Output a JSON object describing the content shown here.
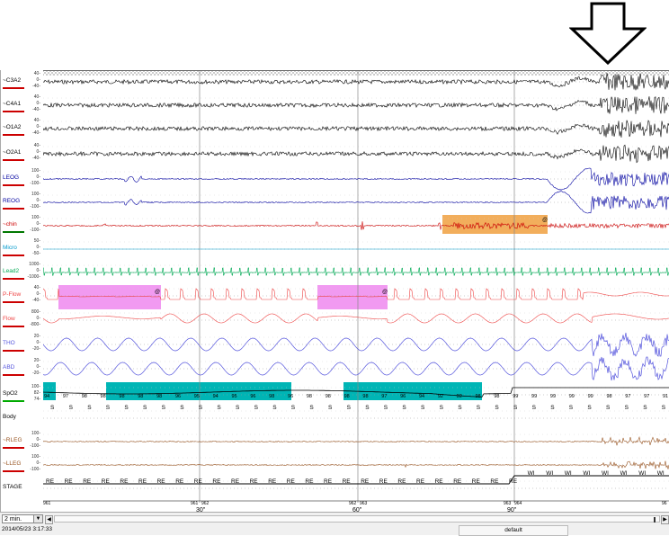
{
  "channels": [
    {
      "name": "~C3A2",
      "ticks": [
        "40-",
        "0-",
        "-40-"
      ],
      "color": "#000000",
      "underline": "#cc0000"
    },
    {
      "name": "~C4A1",
      "ticks": [
        "40-",
        "0-",
        "-40-"
      ],
      "color": "#000000",
      "underline": "#cc0000"
    },
    {
      "name": "~O1A2",
      "ticks": [
        "40-",
        "0-",
        "-40-"
      ],
      "color": "#000000",
      "underline": "#cc0000"
    },
    {
      "name": "~O2A1",
      "ticks": [
        "40-",
        "0-",
        "-40-"
      ],
      "color": "#000000",
      "underline": "#cc0000"
    },
    {
      "name": "LEOG",
      "ticks": [
        "100-",
        "0-",
        "-100-"
      ],
      "color": "#0000a0",
      "underline": "#cc0000"
    },
    {
      "name": "REOG",
      "ticks": [
        "100-",
        "0-",
        "-100-"
      ],
      "color": "#0000a0",
      "underline": "#cc0000"
    },
    {
      "name": "~chin",
      "ticks": [
        "100-",
        "0-",
        "-100-"
      ],
      "color": "#cc0000",
      "underline": "#007700"
    },
    {
      "name": "Micro",
      "ticks": [
        "50-",
        "0-",
        "-50-"
      ],
      "color": "#0099cc",
      "underline": "#cc0000"
    },
    {
      "name": "Lead2",
      "ticks": [
        "1000-",
        "0-",
        "-1000-"
      ],
      "color": "#00aa55",
      "underline": "#cc0000"
    },
    {
      "name": "P-Flow",
      "ticks": [
        "40-",
        "0-",
        "-40-"
      ],
      "color": "#ee4444",
      "underline": "#cc0000"
    },
    {
      "name": "Flow",
      "ticks": [
        "800-",
        "0-",
        "-800-"
      ],
      "color": "#ee4444",
      "underline": "#cc0000"
    },
    {
      "name": "THO",
      "ticks": [
        "20-",
        "0-",
        "-20-"
      ],
      "color": "#5555dd",
      "underline": "#cc0000"
    },
    {
      "name": "ABD",
      "ticks": [
        "20-",
        "0-",
        "-20-"
      ],
      "color": "#5555dd",
      "underline": "#cc0000"
    },
    {
      "name": "SpO2",
      "ticks": [
        "100-",
        "82-",
        "74-"
      ],
      "color": "#000000",
      "underline": "#00aa00"
    },
    {
      "name": "Body",
      "ticks": [],
      "color": "#000000",
      "underline": ""
    },
    {
      "name": "~RLEG",
      "ticks": [
        "100-",
        "0-",
        "-100-"
      ],
      "color": "#995522",
      "underline": "#cc0000"
    },
    {
      "name": "~LLEG",
      "ticks": [
        "100-",
        "0-",
        "-100-"
      ],
      "color": "#995522",
      "underline": "#cc0000"
    },
    {
      "name": "STAGE",
      "ticks": [],
      "color": "#000000",
      "underline": ""
    }
  ],
  "spo2_values": [
    "94",
    "97",
    "98",
    "98",
    "98",
    "98",
    "98",
    "96",
    "95",
    "94",
    "95",
    "96",
    "98",
    "96",
    "98",
    "98",
    "98",
    "98",
    "97",
    "96",
    "94",
    "92",
    "92",
    "98",
    "98",
    "99",
    "99",
    "99",
    "99",
    "99",
    "98",
    "97",
    "97",
    "91"
  ],
  "body_position": "S",
  "stages_re": "RE",
  "stages_wi": "WI",
  "epoch_markers": [
    "961",
    "961",
    "962",
    "962",
    "963",
    "963",
    "964",
    "96"
  ],
  "time_labels": [
    "30\"",
    "60\"",
    "90\""
  ],
  "events": {
    "desaturation_label": "@",
    "arousal_label": "@",
    "hypopnea_label": "@"
  },
  "colors": {
    "hypopnea": "#ee88ee",
    "arousal": "#f0a040",
    "desaturation": "#00b5b5",
    "grid": "#888888"
  },
  "footer": {
    "epoch_length": "2 min.",
    "datetime": "2014/05/23 3:17:33",
    "mode": "default"
  },
  "icons": {
    "indicator": "down-arrow-icon",
    "dropdown": "chevron-down-icon",
    "scroll_left": "scroll-left-icon"
  }
}
